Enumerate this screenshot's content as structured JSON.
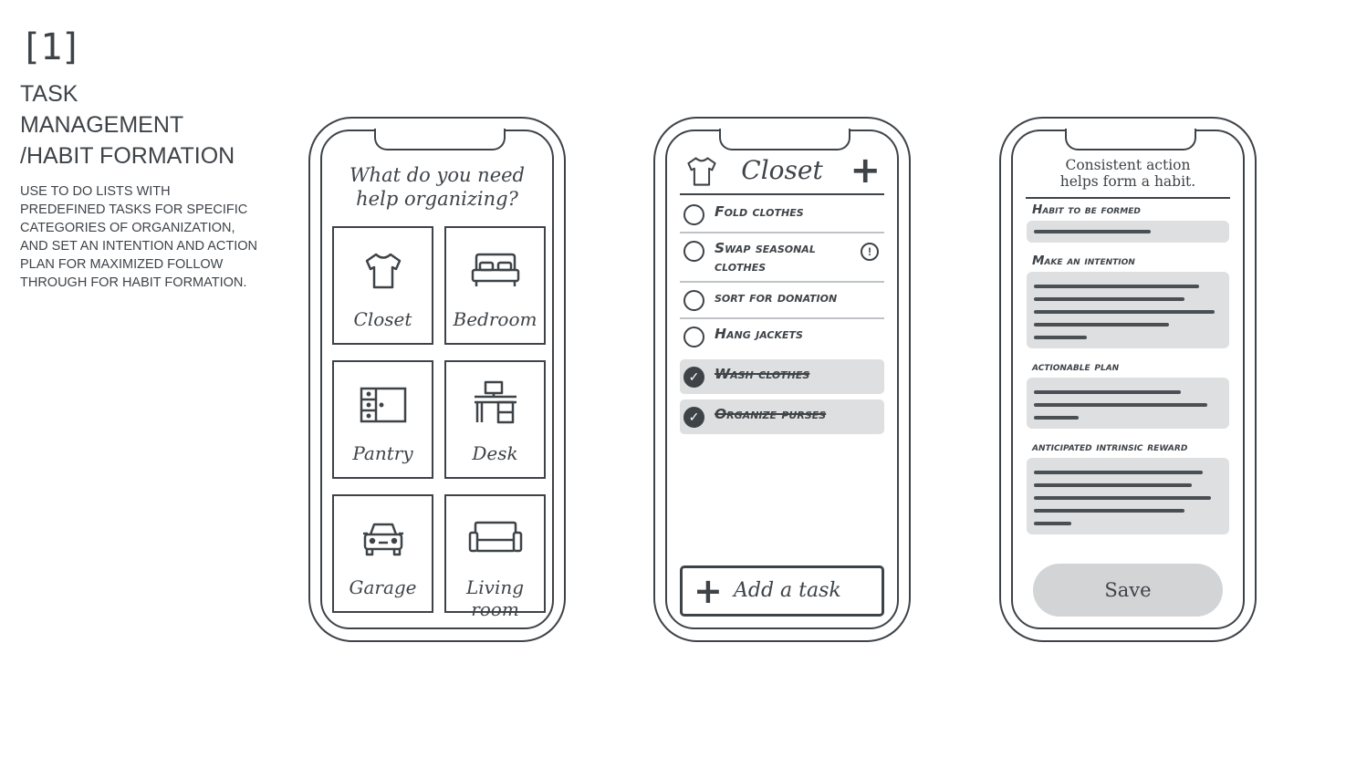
{
  "intro": {
    "number": "[1]",
    "title_lines": [
      "TASK",
      "MANAGEMENT",
      "/HABIT FORMATION"
    ],
    "description": "USE TO DO LISTS WITH PREDEFINED TASKS FOR SPECIFIC CATEGORIES OF ORGANIZATION, AND SET AN INTENTION AND ACTION PLAN FOR MAXIMIZED FOLLOW THROUGH FOR HABIT FORMATION."
  },
  "phone1": {
    "question_line1": "What do you need",
    "question_line2": "help organizing?",
    "tiles": [
      {
        "label": "Closet",
        "icon": "shirt-icon"
      },
      {
        "label": "Bedroom",
        "icon": "bed-icon"
      },
      {
        "label": "Pantry",
        "icon": "pantry-icon"
      },
      {
        "label": "Desk",
        "icon": "desk-icon"
      },
      {
        "label": "Garage",
        "icon": "car-icon"
      },
      {
        "label": "Living room",
        "icon": "sofa-icon"
      }
    ]
  },
  "phone2": {
    "title": "Closet",
    "tasks": [
      {
        "label": "Fold clothes",
        "done": false
      },
      {
        "label": "Swap seasonal clothes",
        "done": false,
        "alert": true
      },
      {
        "label": "sort for donation",
        "done": false
      },
      {
        "label": "Hang jackets",
        "done": false
      },
      {
        "label": "Wash clothes",
        "done": true
      },
      {
        "label": "Organize purses",
        "done": true
      }
    ],
    "add_task_label": "Add a task"
  },
  "phone3": {
    "header_line1": "Consistent action",
    "header_line2": "helps form a habit.",
    "sections": {
      "habit": "Habit to be formed",
      "intention": "Make an intention",
      "plan": "actionable plan",
      "reward": "anticipated intrinsic reward"
    },
    "save_label": "Save"
  }
}
